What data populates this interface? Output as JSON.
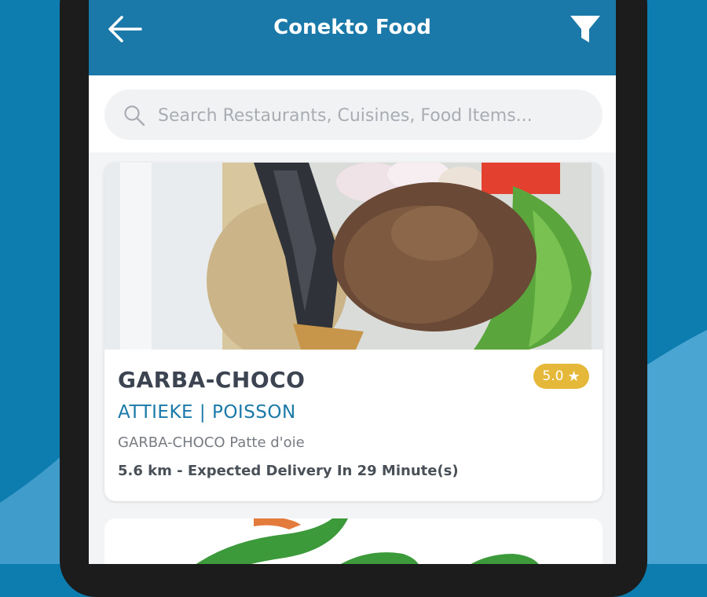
{
  "header": {
    "title": "Conekto Food",
    "back_icon": "arrow-left-icon",
    "filter_icon": "funnel-icon"
  },
  "search": {
    "placeholder": "Search Restaurants, Cuisines, Food Items...",
    "value": ""
  },
  "restaurants": [
    {
      "name": "GARBA-CHOCO",
      "rating": "5.0",
      "cuisine": "ATTIEKE | POISSON",
      "address": "GARBA-CHOCO Patte d'oie",
      "delivery": "5.6 km - Expected Delivery In 29 Minute(s)"
    }
  ],
  "colors": {
    "primary": "#1a79a8",
    "rating_badge": "#e6b83a",
    "background": "#0d7db0"
  }
}
